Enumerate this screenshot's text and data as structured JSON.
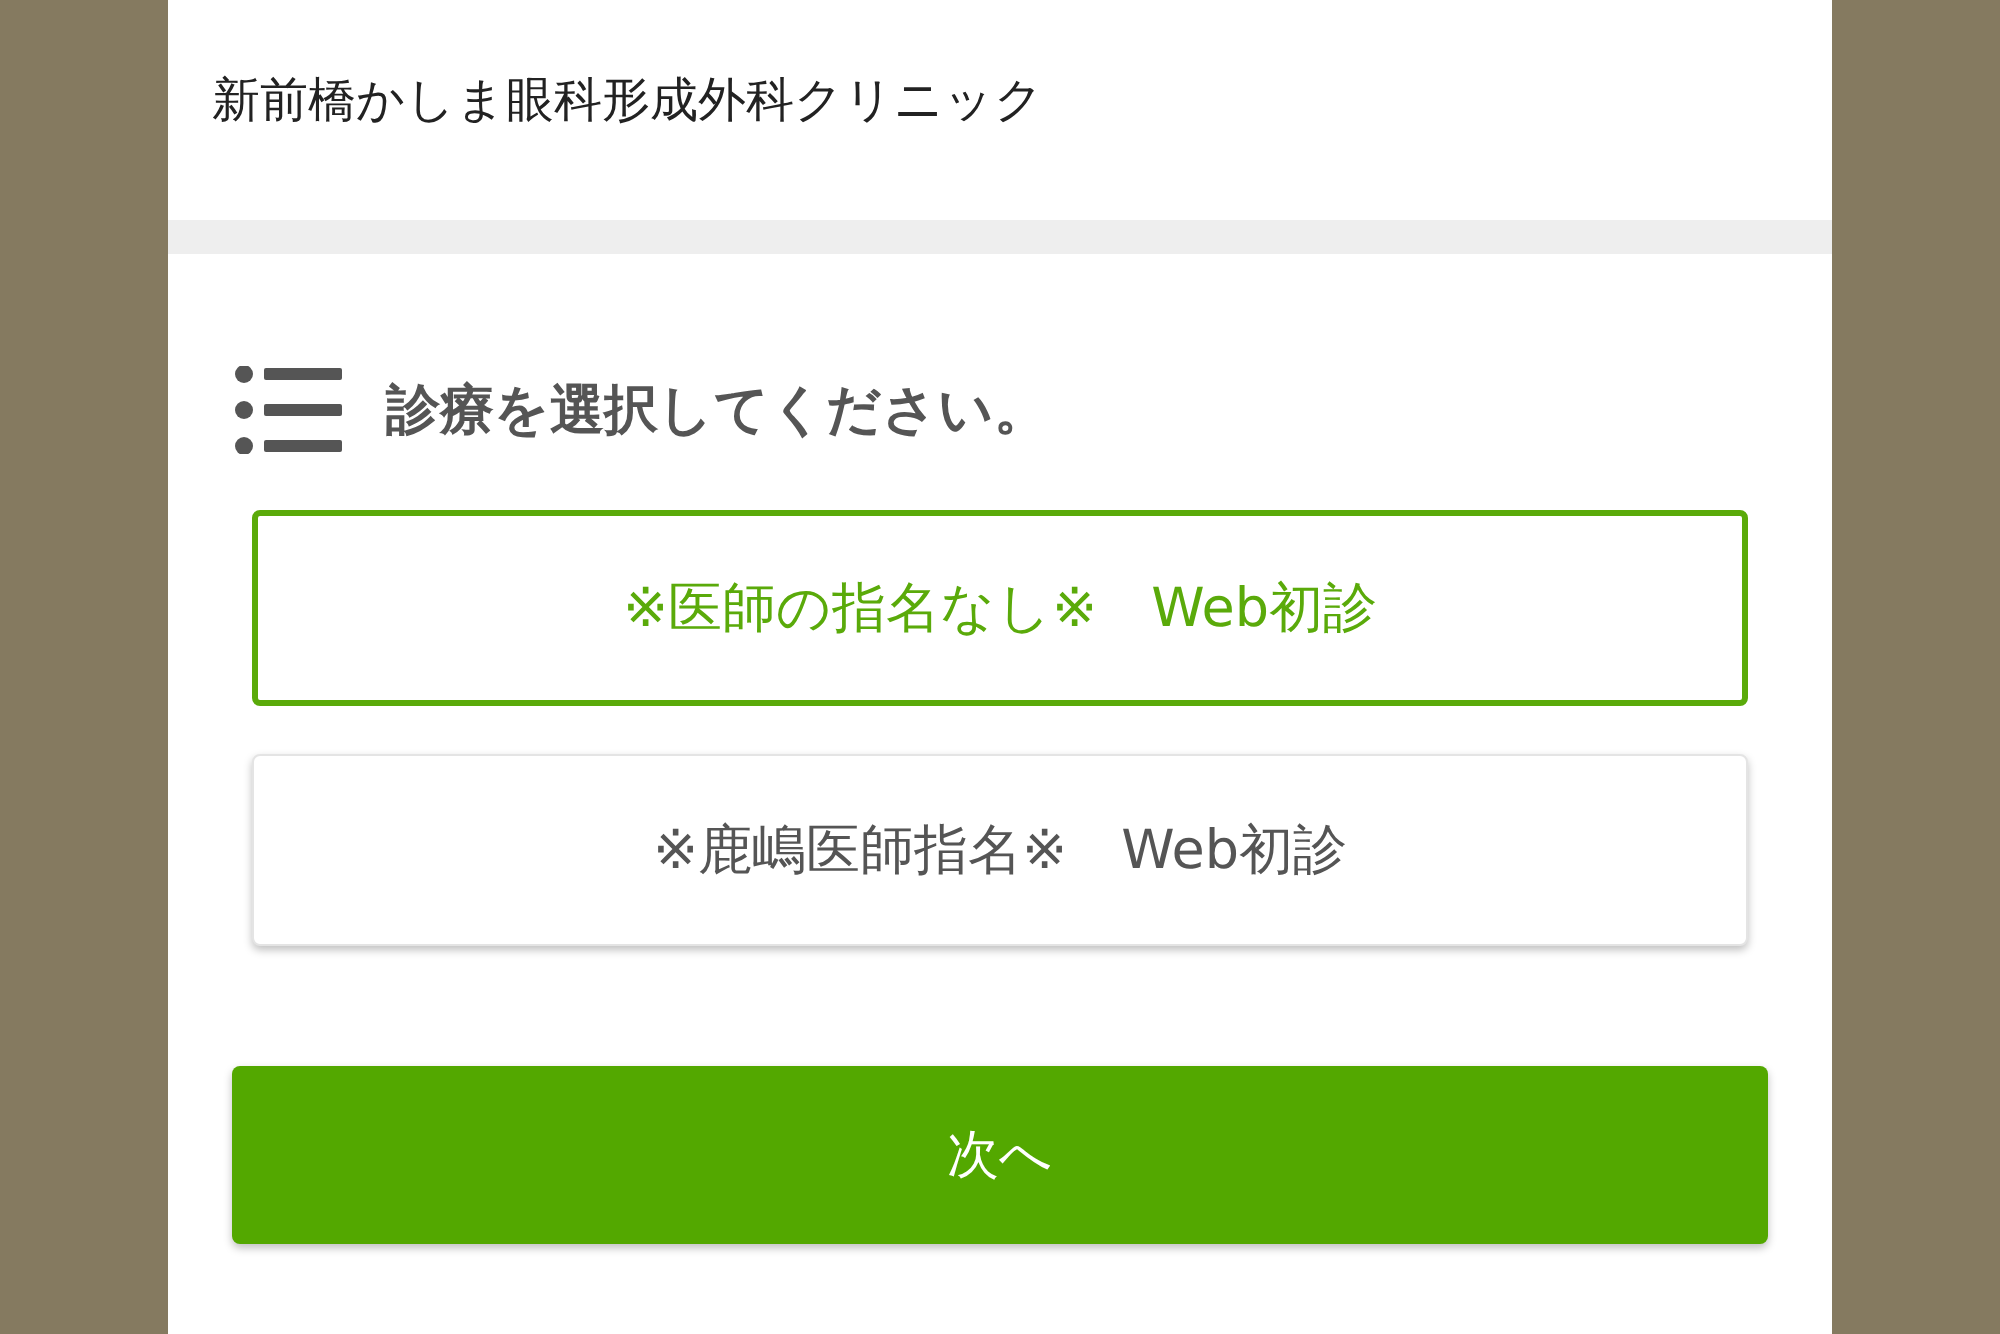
{
  "header": {
    "title": "新前橋かしま眼科形成外科クリニック"
  },
  "heading": "診療を選択してください。",
  "options": [
    {
      "label": "※医師の指名なし※　Web初診",
      "selected": true
    },
    {
      "label": "※鹿嶋医師指名※　Web初診",
      "selected": false
    }
  ],
  "next_button": "次へ"
}
